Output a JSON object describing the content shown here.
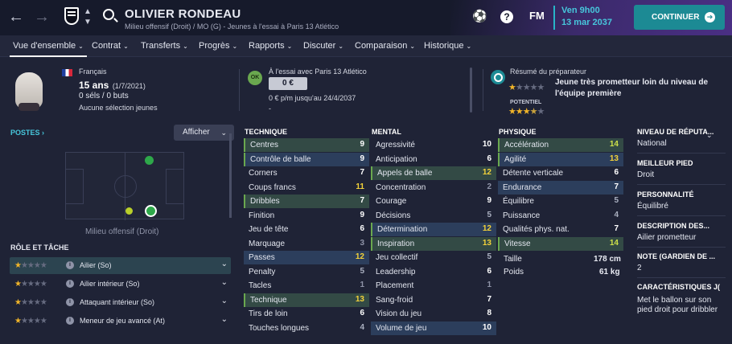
{
  "header": {
    "player_name": "OLIVIER RONDEAU",
    "subtitle": "Milieu offensif (Droit) / MO (G) - Jeunes à l'essai à Paris 13 Atlético",
    "fm_label": "FM",
    "help_label": "?",
    "date_line1": "Ven 9h00",
    "date_line2": "13 mar 2037",
    "continue_label": "CONTINUER"
  },
  "tabs": [
    {
      "label": "Vue d'ensemble",
      "dropdown": true,
      "active": true
    },
    {
      "label": "Contrat",
      "dropdown": true
    },
    {
      "label": "Transferts",
      "dropdown": true
    },
    {
      "label": "Progrès",
      "dropdown": true
    },
    {
      "label": "Rapports",
      "dropdown": true
    },
    {
      "label": "Discuter",
      "dropdown": true
    },
    {
      "label": "Comparaison",
      "dropdown": true
    },
    {
      "label": "Historique",
      "dropdown": true
    }
  ],
  "profile": {
    "nationality": "Français",
    "age": "15 ans",
    "dob": "(1/7/2021)",
    "caps": "0 séls / 0 buts",
    "youth": "Aucune sélection jeunes"
  },
  "contract": {
    "badge": "OK",
    "trial": "À l'essai avec Paris 13 Atlético",
    "value": "0 €",
    "wage": "0 € p/m jusqu'au 24/4/2037",
    "dash": "-"
  },
  "scout": {
    "title": "Résumé du préparateur",
    "summary": "Jeune très prometteur loin du niveau de l'équipe première",
    "ability_stars": 1,
    "potential_label": "POTENTIEL",
    "potential_stars": 3.5
  },
  "positions": {
    "title": "POSTES",
    "afficher": "Afficher",
    "position_label": "Milieu offensif (Droit)"
  },
  "roles": {
    "title": "RÔLE ET TÂCHE",
    "items": [
      {
        "label": "Ailier (So)",
        "stars": 1,
        "selected": true
      },
      {
        "label": "Ailier intérieur (So)",
        "stars": 1
      },
      {
        "label": "Attaquant intérieur (So)",
        "stars": 1
      },
      {
        "label": "Meneur de jeu avancé (At)",
        "stars": 1
      }
    ]
  },
  "technique": {
    "title": "TECHNIQUE",
    "items": [
      {
        "name": "Centres",
        "value": 9
      },
      {
        "name": "Contrôle de balle",
        "value": 9
      },
      {
        "name": "Corners",
        "value": 7
      },
      {
        "name": "Coups francs",
        "value": 11
      },
      {
        "name": "Dribbles",
        "value": 7
      },
      {
        "name": "Finition",
        "value": 9
      },
      {
        "name": "Jeu de tête",
        "value": 6
      },
      {
        "name": "Marquage",
        "value": 3
      },
      {
        "name": "Passes",
        "value": 12
      },
      {
        "name": "Penalty",
        "value": 5
      },
      {
        "name": "Tacles",
        "value": 1
      },
      {
        "name": "Technique",
        "value": 13
      },
      {
        "name": "Tirs de loin",
        "value": 6
      },
      {
        "name": "Touches longues",
        "value": 4
      }
    ]
  },
  "mental": {
    "title": "MENTAL",
    "items": [
      {
        "name": "Agressivité",
        "value": 10
      },
      {
        "name": "Anticipation",
        "value": 6
      },
      {
        "name": "Appels de balle",
        "value": 12
      },
      {
        "name": "Concentration",
        "value": 2
      },
      {
        "name": "Courage",
        "value": 9
      },
      {
        "name": "Décisions",
        "value": 5
      },
      {
        "name": "Détermination",
        "value": 12
      },
      {
        "name": "Inspiration",
        "value": 13
      },
      {
        "name": "Jeu collectif",
        "value": 5
      },
      {
        "name": "Leadership",
        "value": 6
      },
      {
        "name": "Placement",
        "value": 1
      },
      {
        "name": "Sang-froid",
        "value": 7
      },
      {
        "name": "Vision du jeu",
        "value": 8
      },
      {
        "name": "Volume de jeu",
        "value": 10
      }
    ]
  },
  "physique": {
    "title": "PHYSIQUE",
    "items": [
      {
        "name": "Accélération",
        "value": 14
      },
      {
        "name": "Agilité",
        "value": 13
      },
      {
        "name": "Détente verticale",
        "value": 6
      },
      {
        "name": "Endurance",
        "value": 7
      },
      {
        "name": "Équilibre",
        "value": 5
      },
      {
        "name": "Puissance",
        "value": 4
      },
      {
        "name": "Qualités phys. nat.",
        "value": 7
      },
      {
        "name": "Vitesse",
        "value": 14
      }
    ],
    "height_label": "Taille",
    "height": "178 cm",
    "weight_label": "Poids",
    "weight": "61 kg"
  },
  "info": {
    "reputation_title": "NIVEAU DE RÉPUTA...",
    "reputation": "National",
    "foot_title": "MEILLEUR PIED",
    "foot": "Droit",
    "personality_title": "PERSONNALITÉ",
    "personality": "Équilibré",
    "description_title": "DESCRIPTION DES...",
    "description": "Ailier prometteur",
    "gk_title": "NOTE (GARDIEN DE ...",
    "gk": "2",
    "traits_title": "CARACTÉRISTIQUES J(",
    "traits": "Met le ballon sur son pied droit pour dribbler"
  }
}
